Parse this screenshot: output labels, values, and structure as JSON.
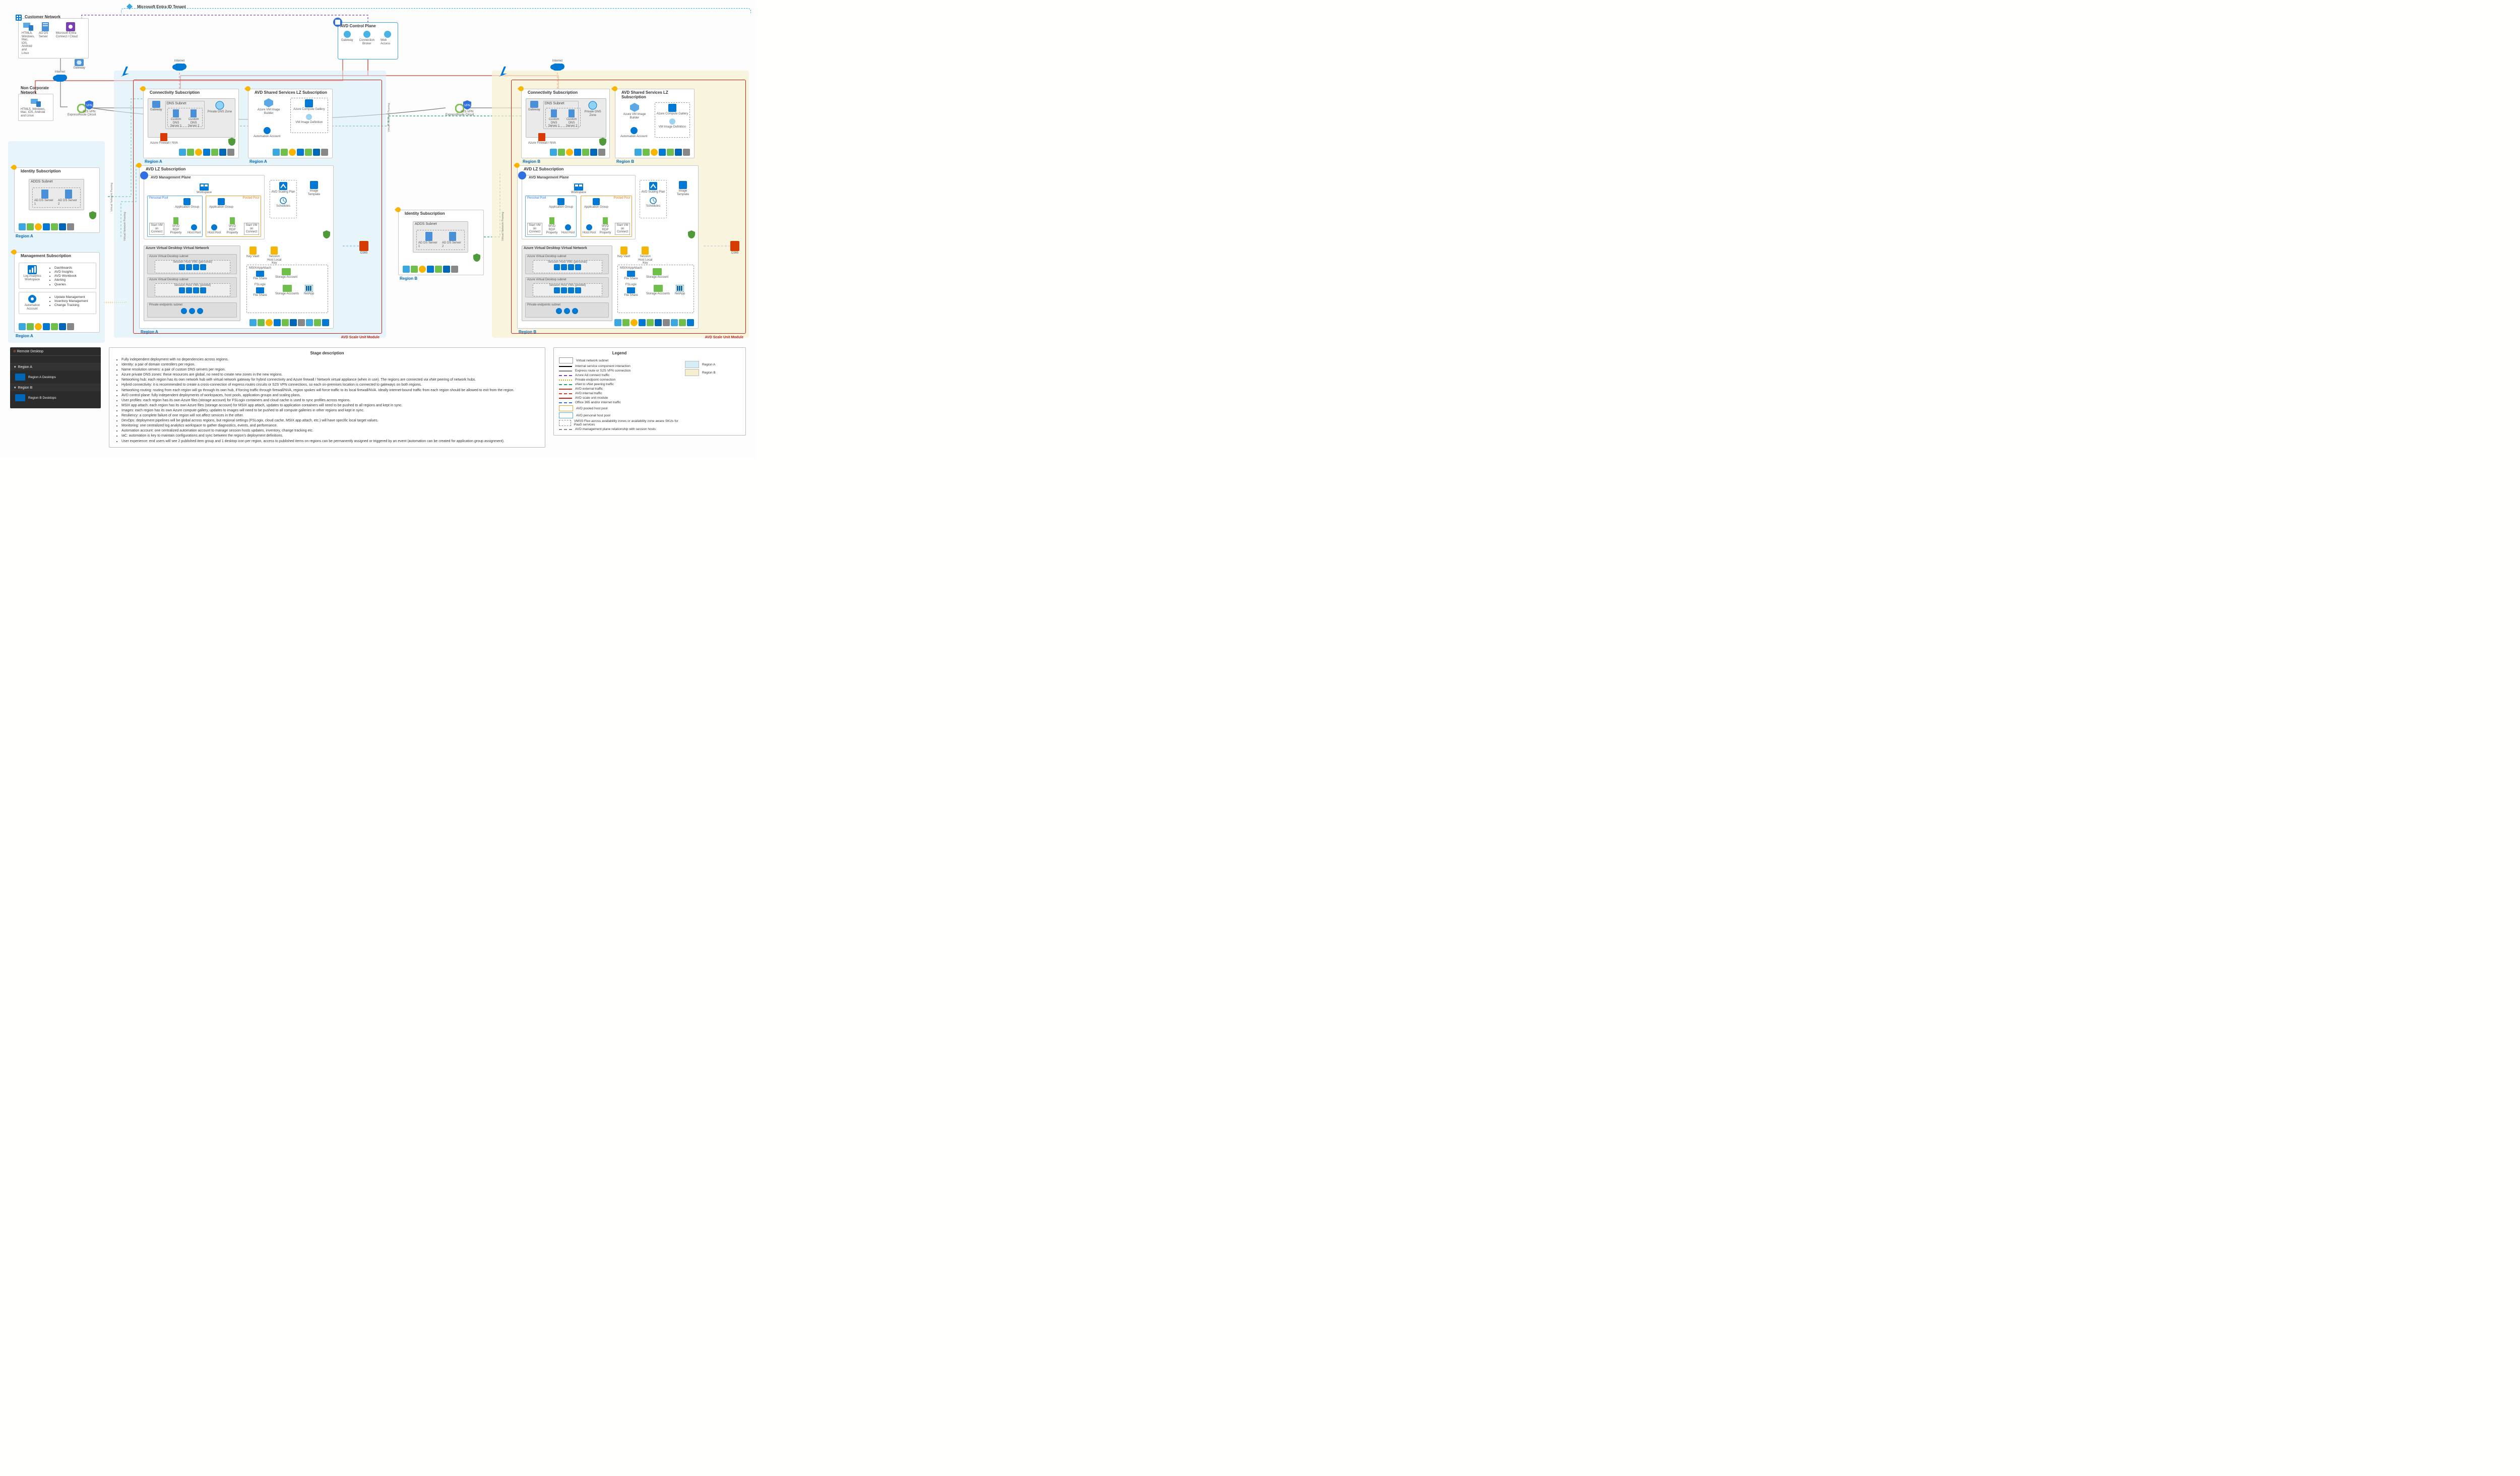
{
  "tenant": "Microsoft Entra ID Tenant",
  "customer": {
    "title": "Customer Network",
    "clients": "HTML5, Windows, Mac, iOS, Android and Linux",
    "adds": "AD DS Server",
    "entra": "Microsoft Entra Connect / Cloud",
    "gateway": "Gateway"
  },
  "noncorp": {
    "title": "Non Corporate Network",
    "clients": "HTML5, Windows, Mac, iOS, Android and Linux"
  },
  "internet": "Internet",
  "express": "ExpressRoute Circuit",
  "s2s": "S2S VPN",
  "control_plane": {
    "title": "AVD Control Plane",
    "gateway": "Gateway",
    "broker": "Connection Broker",
    "web": "Web Access"
  },
  "o365": "O365",
  "peering": "Virtual Network Peering",
  "identity": {
    "title": "Identity Subscription",
    "subnet": "ADDS Subnet",
    "s1": "AD DS Server 1",
    "s2": "AD DS Server 2",
    "regionA": "Region A",
    "regionB": "Region B"
  },
  "mgmt": {
    "title": "Management Subscription",
    "law": "Log Analytics Workspace",
    "lawItems": [
      "Dashboards",
      "AVD Insights",
      "AVD Workbook",
      "Alerting",
      "Queries"
    ],
    "auto": "Automation Account",
    "autoItems": [
      "Update Management",
      "Inventory Management",
      "Change Tracking"
    ],
    "region": "Region A"
  },
  "conn": {
    "title": "Connectivity Subscription",
    "gateway": "Gateway",
    "dnsSubnet": "DNS Subnet",
    "dns1": "Custom DNS Server 1",
    "dns2": "Custom DNS Server 2",
    "fw": "Azure Firewall / NVA",
    "pdns": "Private DNS Zone",
    "regionA": "Region A",
    "regionB": "Region B"
  },
  "shared": {
    "title": "AVD Shared Services LZ Subscription",
    "builder": "Azure VM Image Builder",
    "gallery": "Azure Compute Gallery",
    "imgdef": "VM Image Definition",
    "auto": "Automation Account",
    "regionA": "Region A",
    "regionB": "Region B"
  },
  "avdlz": {
    "title": "AVD LZ Subscription",
    "mgmtPlane": "AVD Management Plane",
    "workspace": "Workspace",
    "personal": "Personal Pool",
    "pooled": "Pooled Pool",
    "appGroup": "Application Group",
    "startvm": "Start VM on Connect",
    "rdp": "WVD RDP Property",
    "hostpool": "Host Pool",
    "scaling": "AVD Scaling Plan",
    "schedules": "Schedules",
    "imgtpl": "Image Template",
    "vnet": "Azure Virtual Desktop Virtual Network",
    "subnet1": "Azure Virtual Desktop subnet",
    "sh_personal": "Session Host VMs (personal)",
    "sh_pooled": "Session Host VMs (pooled)",
    "pe_subnet": "Private endpoints subnet",
    "kv": "Key Vault",
    "kv_host": "Session Host Local Key",
    "msix": "MSIX/AppAttach",
    "fileshare": "File Share",
    "storage": "Storage Account",
    "fslogix": "FSLogix",
    "storage2": "Storage Accounts",
    "netapp": "NetApp",
    "regionA": "Region A",
    "regionB": "Region B"
  },
  "scale_unit": "AVD Scale Unit Module",
  "rd": {
    "title": "Remote Desktop",
    "secA": "Region A",
    "itemA": "Region A Desktops",
    "secB": "Region B",
    "itemB": "Region B Desktops"
  },
  "stage": {
    "title": "Stage description",
    "items": [
      "Fully independent deployment with no dependencies across regions.",
      "Identity: a pair of domain controllers per region.",
      "Name resolution servers: a pair of custom DNS servers per region.",
      "Azure private DNS zones: these resources are global, no need to create new zones in the new regions.",
      "Networking hub: each region has its own network hub with virtual network gateway for hybrid connectivity and Azure firewall / Network virtual appliance (when in use). The regions are connected via vNet peering of network hubs.",
      "Hybrid connectivity: it is recommended to create a cross-connection of express routes circuits or S2S VPN connections, so each on-premises location is connected to gateways on both regions.",
      "Networking routing: routing from each region will go through its own hub, if forcing traffic through firewall/NVA, region spokes will force traffic to its local firewall/NVA. Ideally internet-bound traffic from each region should be allowed to exit from the region.",
      "AVD control plane: fully independent deployments of workspaces, host pools, application groups and scaling plans.",
      "User profiles: each region has its own Azure files (storage account) for FSLogix containers and cloud cache is used to sync profiles across regions.",
      "MSIX app attach: each region has its own Azure files (storage account) for MSIX app attach, updates to application containers will need to be pushed to all regions and kept in sync.",
      "Images: each region has its own Azure compute gallery, updates to images will need to be pushed to all compute galleries in other regions and kept in sync.",
      "Resiliency: a complete failure of one region will not affect services in the other.",
      "DevOps: deployment pipelines will be global across regions, but regional settings (FSLogix, cloud cache, MSIX app attach, etc.) will have specific local target values.",
      "Monitoring: one centralized log analytics workspace to gather diagnostics, events, and performance.",
      "Automation account: one centralized automation account to manage session hosts updates, inventory, change tracking etc.",
      "IaC: automation is key to maintain configurations and sync between the region's deployment definitions.",
      "User experience: end users will see 2 published item group and 1 desktop icon per region, access to published items on regions can be permanently assigned or triggered by an event (automation can be created for application group assignment)."
    ]
  },
  "legend": {
    "title": "Legend",
    "left": [
      {
        "t": "Virtual network  subnet",
        "k": "box",
        "c": "#999"
      },
      {
        "t": "Internal service component interaction",
        "k": "solid",
        "c": "#000"
      },
      {
        "t": "Express route or S2S VPN connection",
        "k": "solid",
        "c": "#7a7a7a"
      },
      {
        "t": "Azure Ad connect traffic",
        "k": "dash",
        "c": "#7a3fb5"
      },
      {
        "t": "Private endpoint connection",
        "k": "dot",
        "c": "#d9a400"
      },
      {
        "t": "vNet to vNet peering traffic",
        "k": "dash",
        "c": "#1aa36b"
      },
      {
        "t": "AVD external traffic",
        "k": "solid",
        "c": "#d63b2a"
      },
      {
        "t": "AVD internal traffic",
        "k": "dash",
        "c": "#d63b2a"
      },
      {
        "t": "AVD scale unit module",
        "k": "solid",
        "c": "#c42014"
      },
      {
        "t": "Office 365 and/or internet traffic",
        "k": "dash",
        "c": "#2f6fe0"
      },
      {
        "t": "AVD pooled host pool",
        "k": "box",
        "c": "#e8a13a"
      },
      {
        "t": "AVD personal host pool",
        "k": "box",
        "c": "#5aa8e6"
      },
      {
        "t": "VMSS Flex across availability zones or availability zone aware SKUs for PaaS services",
        "k": "dbox",
        "c": "#888"
      },
      {
        "t": "AVD management plane relationship with session hosts",
        "k": "dash",
        "c": "#888"
      }
    ],
    "right": [
      {
        "t": "Region A",
        "c": "#d6ecf7"
      },
      {
        "t": "Region B",
        "c": "#f6efcf"
      }
    ]
  }
}
